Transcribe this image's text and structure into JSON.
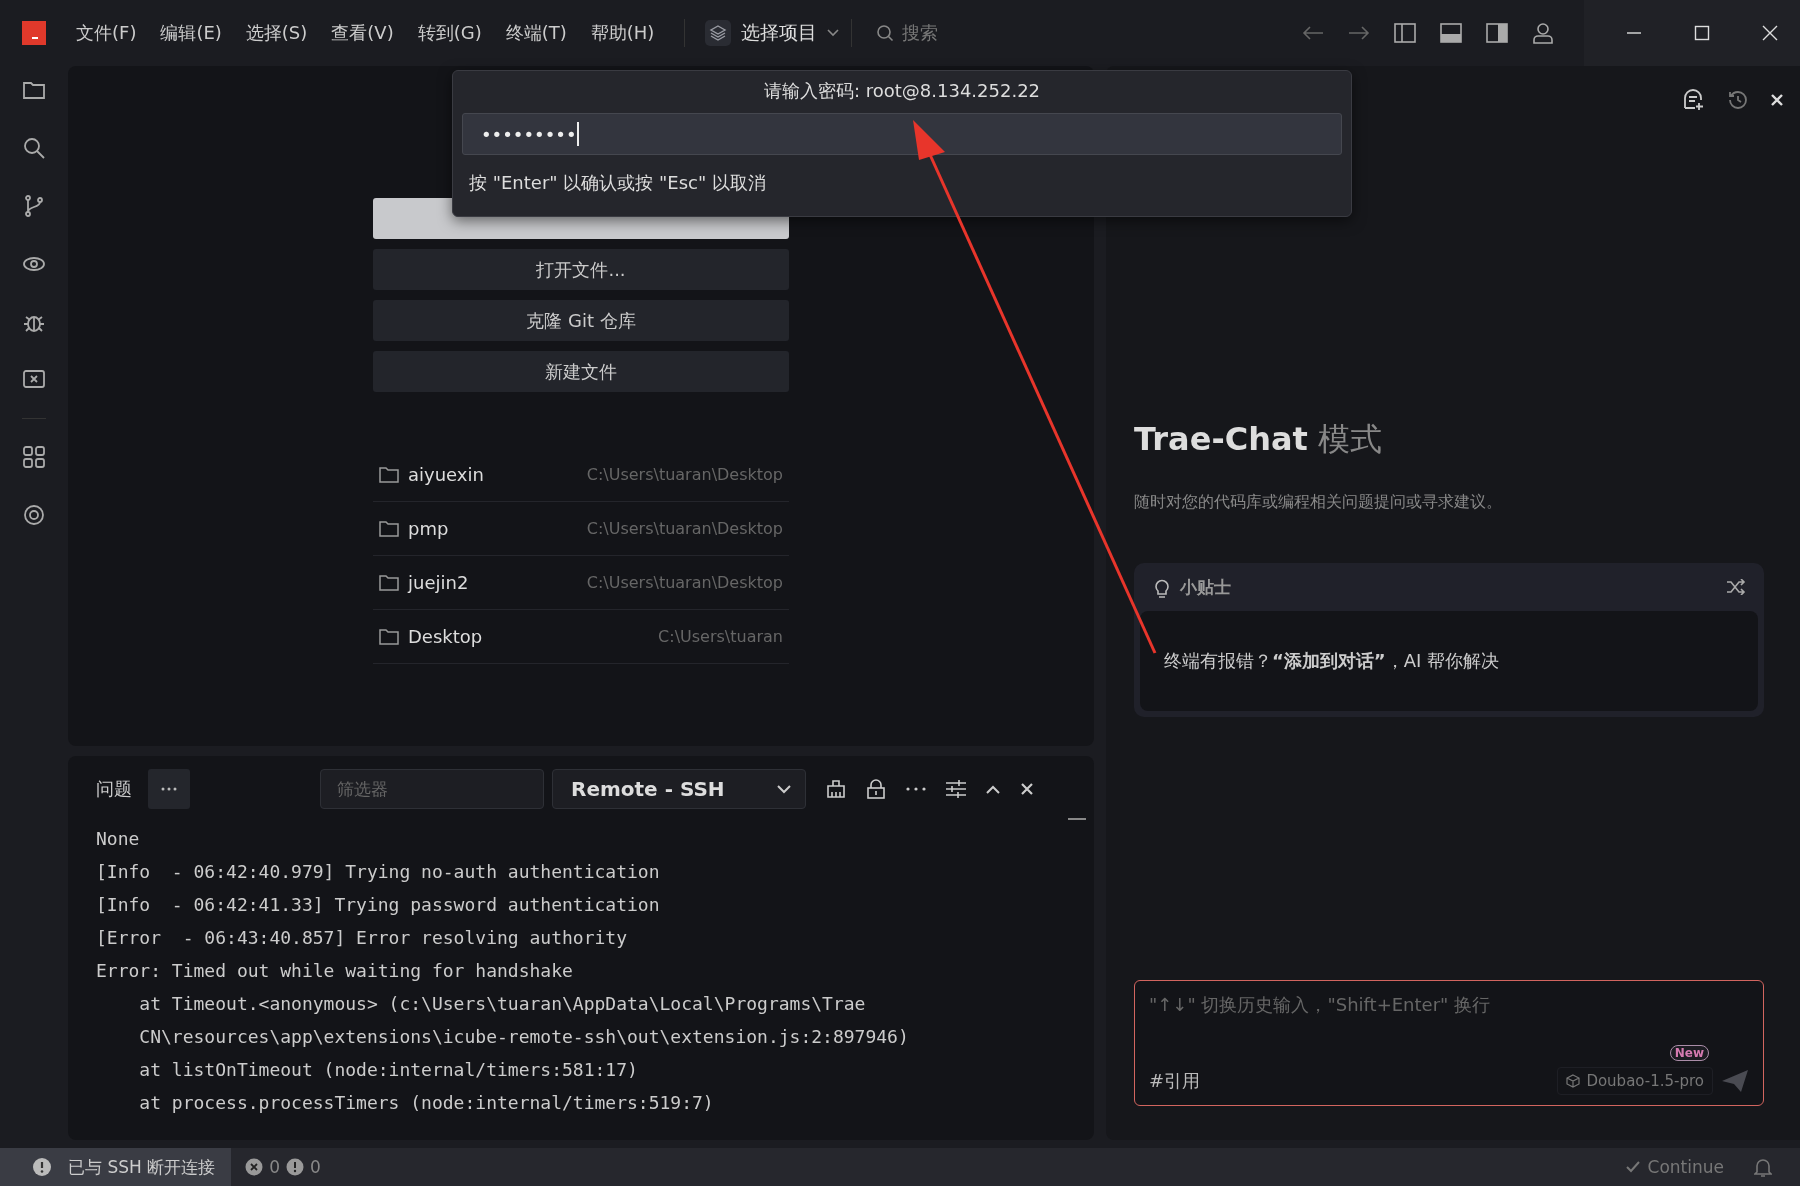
{
  "title_bar": {
    "menu": [
      "文件(F)",
      "编辑(E)",
      "选择(S)",
      "查看(V)",
      "转到(G)",
      "终端(T)",
      "帮助(H)"
    ],
    "project_picker": "选择项目",
    "search_placeholder": "搜索"
  },
  "password_prompt": {
    "title": "请输入密码: root@8.134.252.22",
    "value": "•••••••••",
    "hint": "按 \"Enter\" 以确认或按 \"Esc\" 以取消"
  },
  "welcome": {
    "actions": [
      "打开文件...",
      "克隆 Git 仓库",
      "新建文件"
    ],
    "recent": [
      {
        "name": "aiyuexin",
        "path": "C:\\Users\\tuaran\\Desktop"
      },
      {
        "name": "pmp",
        "path": "C:\\Users\\tuaran\\Desktop"
      },
      {
        "name": "juejin2",
        "path": "C:\\Users\\tuaran\\Desktop"
      },
      {
        "name": "Desktop",
        "path": "C:\\Users\\tuaran"
      }
    ]
  },
  "panel": {
    "tab": "问题",
    "filter_placeholder": "筛选器",
    "channel": "Remote - SSH",
    "output": [
      "None",
      "[Info  - 06:42:40.979] Trying no-auth authentication",
      "[Info  - 06:42:41.33] Trying password authentication",
      "[Error  - 06:43:40.857] Error resolving authority",
      "Error: Timed out while waiting for handshake",
      "    at Timeout.<anonymous> (c:\\Users\\tuaran\\AppData\\Local\\Programs\\Trae",
      "    CN\\resources\\app\\extensions\\icube-remote-ssh\\out\\extension.js:2:897946)",
      "    at listOnTimeout (node:internal/timers:581:17)",
      "    at process.processTimers (node:internal/timers:519:7)"
    ]
  },
  "chat": {
    "title": "Trae-Chat",
    "title_suffix": "模式",
    "subtitle": "随时对您的代码库或编程相关问题提问或寻求建议。",
    "tip": {
      "label": "小贴士",
      "text": "终端有报错？**“添加到对话”**，AI 帮你解决"
    },
    "input_placeholder": "\"↑↓\" 切换历史输入，\"Shift+Enter\" 换行",
    "reference": "#引用",
    "model": "Doubao-1.5-pro",
    "badge": "New"
  },
  "status_bar": {
    "connection": "已与 SSH 断开连接",
    "errors": "0",
    "warnings": "0",
    "continue": "Continue"
  }
}
